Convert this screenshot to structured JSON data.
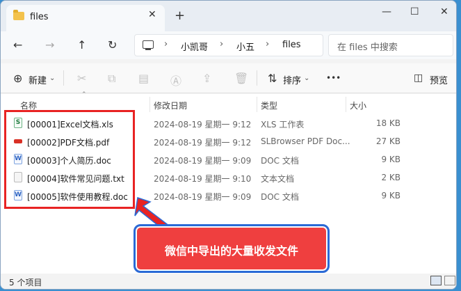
{
  "window": {
    "tab_title": "files",
    "tab_close": "✕",
    "new_tab": "+",
    "minimize": "—",
    "maximize": "☐",
    "close": "✕"
  },
  "nav": {
    "back": "←",
    "forward": "→",
    "up": "↑",
    "refresh": "↻"
  },
  "breadcrumb": [
    "小凯哥",
    "小五",
    "files"
  ],
  "breadcrumb_sep": "›",
  "search": {
    "placeholder": "在 files 中搜索"
  },
  "toolbar": {
    "new_label": "新建",
    "sort_label": "排序",
    "more": "•••",
    "preview_label": "预览"
  },
  "columns": {
    "name": "名称",
    "date": "修改日期",
    "type": "类型",
    "size": "大小"
  },
  "files": [
    {
      "name": "[00001]Excel文档.xls",
      "date": "2024-08-19 星期一 9:12",
      "type": "XLS 工作表",
      "size": "18 KB",
      "icon": "xls-file-icon"
    },
    {
      "name": "[00002]PDF文档.pdf",
      "date": "2024-08-19 星期一 9:12",
      "type": "SLBrowser PDF Doc...",
      "size": "27 KB",
      "icon": "pdf-file-icon"
    },
    {
      "name": "[00003]个人简历.doc",
      "date": "2024-08-19 星期一 9:09",
      "type": "DOC 文档",
      "size": "9 KB",
      "icon": "doc-file-icon"
    },
    {
      "name": "[00004]软件常见问题.txt",
      "date": "2024-08-19 星期一 9:10",
      "type": "文本文档",
      "size": "2 KB",
      "icon": "txt-file-icon"
    },
    {
      "name": "[00005]软件使用教程.doc",
      "date": "2024-08-19 星期一 9:09",
      "type": "DOC 文档",
      "size": "9 KB",
      "icon": "doc-file-icon"
    }
  ],
  "annotation": {
    "text": "微信中导出的大量收发文件",
    "color": "#ef3f3f",
    "border": "#2a6ad6"
  },
  "status": {
    "count_text": "5 个项目"
  },
  "colors": {
    "highlight": "#e82323"
  }
}
